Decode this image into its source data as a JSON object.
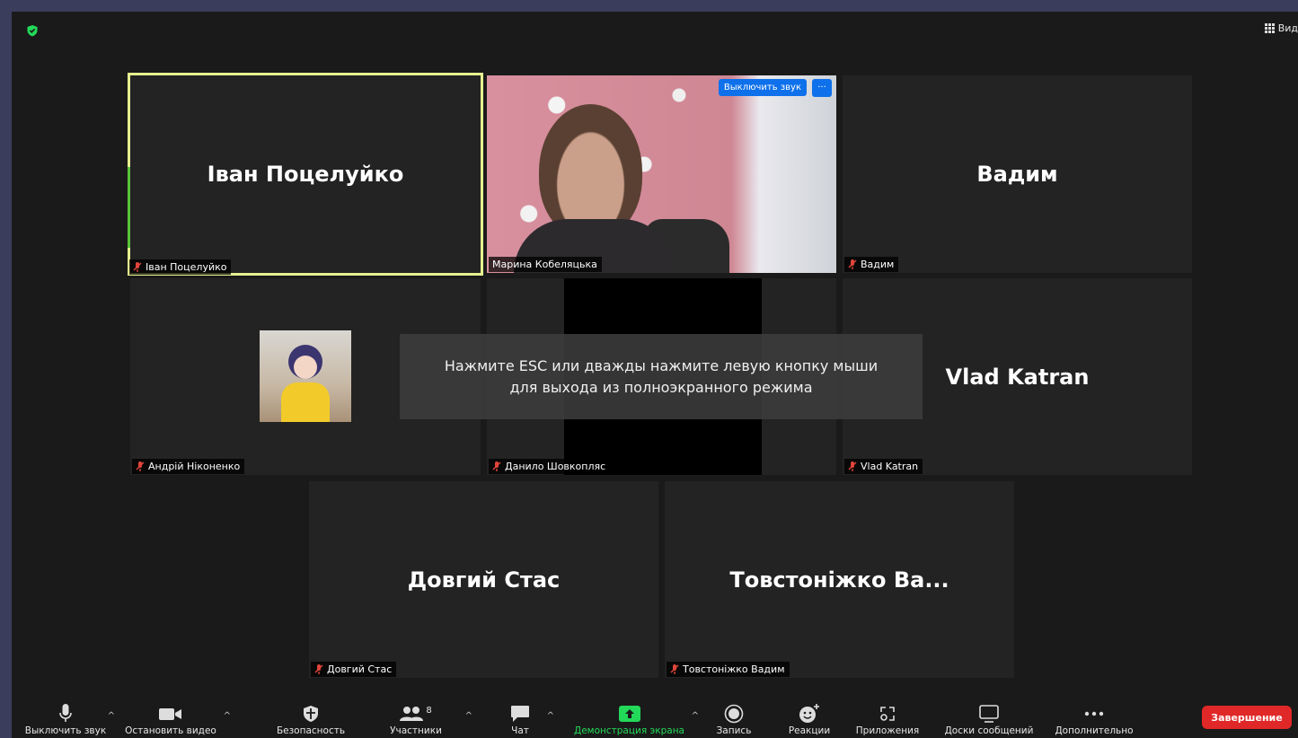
{
  "top_right": {
    "view_label": "Вид"
  },
  "overlay": {
    "line1": "Нажмите ESC или дважды нажмите левую кнопку мыши",
    "line2": "для выхода из полноэкранного режима"
  },
  "participants": [
    {
      "display_name": "Іван Поцелуйко",
      "tag": "Іван Поцелуйко",
      "muted": true
    },
    {
      "display_name": "",
      "tag": "Марина Кобеляцька",
      "muted": false
    },
    {
      "display_name": "Вадим",
      "tag": "Вадим",
      "muted": true
    },
    {
      "display_name": "",
      "tag": "Андрій Ніконенко",
      "muted": true
    },
    {
      "display_name": "",
      "tag": "Данило Шовкопляс",
      "muted": true
    },
    {
      "display_name": "Vlad Katran",
      "tag": "Vlad Katran",
      "muted": true
    },
    {
      "display_name": "Довгий Стас",
      "tag": "Довгий Стас",
      "muted": true
    },
    {
      "display_name": "Товстоніжко Ва...",
      "tag": "Товстоніжко Вадим",
      "muted": true
    }
  ],
  "video_tile_buttons": {
    "unmute": "Выключить звук",
    "more": "···"
  },
  "toolbar": {
    "mute": "Выключить звук",
    "stop_video": "Остановить видео",
    "security": "Безопасность",
    "participants": "Участники",
    "participants_count": "8",
    "chat": "Чат",
    "share": "Демонстрация экрана",
    "record": "Запись",
    "reactions": "Реакции",
    "apps": "Приложения",
    "whiteboards": "Доски сообщений",
    "more": "Дополнительно",
    "end": "Завершение"
  },
  "colors": {
    "share_green": "#23d959",
    "end_red": "#e02828",
    "mute_red": "#e0453b",
    "active_border": "#e6f090",
    "blue": "#0e71eb"
  }
}
